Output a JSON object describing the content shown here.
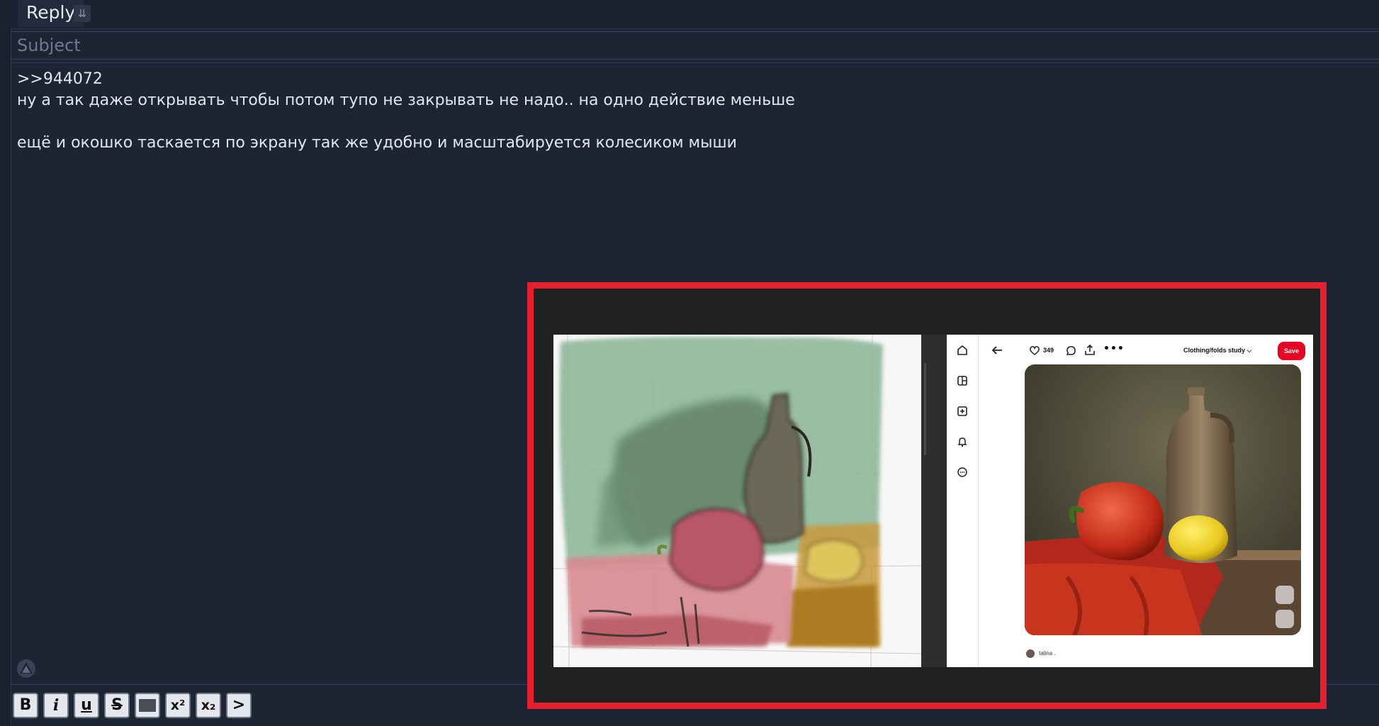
{
  "form": {
    "reply_tab_label": "Reply",
    "subject_placeholder": "Subject",
    "comment_lines": [
      ">>944072",
      "ну а так даже открывать чтобы потом тупо не закрывать не надо.. на одно действие меньше",
      "",
      "ещё и окошко таскается по экрану так же удобно и масштабируется колесиком мыши"
    ]
  },
  "toolbar": {
    "buttons": [
      {
        "label": "B",
        "name": "bold-button"
      },
      {
        "label": "i",
        "name": "italic-button"
      },
      {
        "label": "u",
        "name": "underline-button"
      },
      {
        "label": "S",
        "name": "strikethrough-button"
      },
      {
        "label": "",
        "name": "spoiler-button"
      },
      {
        "label": "x²",
        "name": "superscript-button"
      },
      {
        "label": "x₂",
        "name": "subscript-button"
      },
      {
        "label": ">",
        "name": "quote-button"
      }
    ]
  },
  "embedded_screenshot": {
    "highlight_color": "#e5202f",
    "pinterest": {
      "like_count": "349",
      "board_name": "Clothing/folds study ⌵",
      "save_label": "Save",
      "save_color": "#e60023",
      "author": "talina ."
    }
  },
  "icons": [
    "collapse-arrow-icon",
    "sage-icon",
    "home-icon",
    "explore-icon",
    "create-icon",
    "notifications-icon",
    "messages-icon",
    "back-arrow-icon",
    "heart-icon",
    "comment-icon",
    "share-icon",
    "more-icon",
    "expand-icon",
    "visual-search-icon"
  ]
}
